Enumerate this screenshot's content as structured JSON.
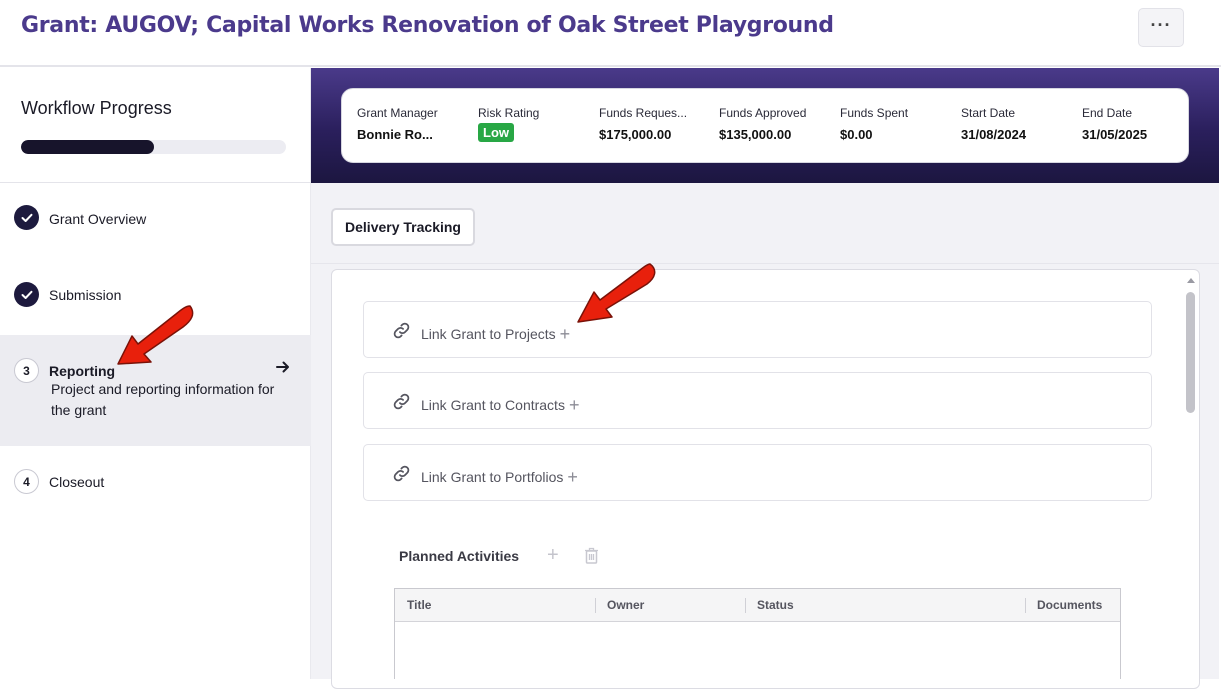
{
  "header": {
    "title": "Grant: AUGOV; Capital Works Renovation of Oak Street Playground",
    "more_label": "···"
  },
  "sidebar": {
    "title": "Workflow Progress",
    "progress_percent": 50,
    "steps": [
      {
        "number": "",
        "label": "Grant Overview",
        "state": "done"
      },
      {
        "number": "",
        "label": "Submission",
        "state": "done"
      },
      {
        "number": "3",
        "label": "Reporting",
        "state": "active",
        "description": "Project and reporting information for the grant"
      },
      {
        "number": "4",
        "label": "Closeout",
        "state": "pending"
      }
    ]
  },
  "summary": {
    "fields": [
      {
        "label": "Grant Manager",
        "value": "Bonnie Ro..."
      },
      {
        "label": "Risk Rating",
        "value": "Low"
      },
      {
        "label": "Funds Reques...",
        "value": "$175,000.00"
      },
      {
        "label": "Funds Approved",
        "value": "$135,000.00"
      },
      {
        "label": "Funds Spent",
        "value": "$0.00"
      },
      {
        "label": "Start Date",
        "value": "31/08/2024"
      },
      {
        "label": "End Date",
        "value": "31/05/2025"
      }
    ],
    "risk_color": "#28a745"
  },
  "main": {
    "tab_label": "Delivery Tracking",
    "links": [
      {
        "label": "Link Grant to Projects"
      },
      {
        "label": "Link Grant to Contracts"
      },
      {
        "label": "Link Grant to Portfolios"
      }
    ],
    "planned_activities": {
      "title": "Planned Activities",
      "columns": [
        "Title",
        "Owner",
        "Status",
        "Documents"
      ]
    }
  },
  "colors": {
    "title": "#4b3a8c",
    "banner_top": "#4a3a8a",
    "banner_bottom": "#1c1640",
    "annotation_arrow": "#e8200c"
  }
}
